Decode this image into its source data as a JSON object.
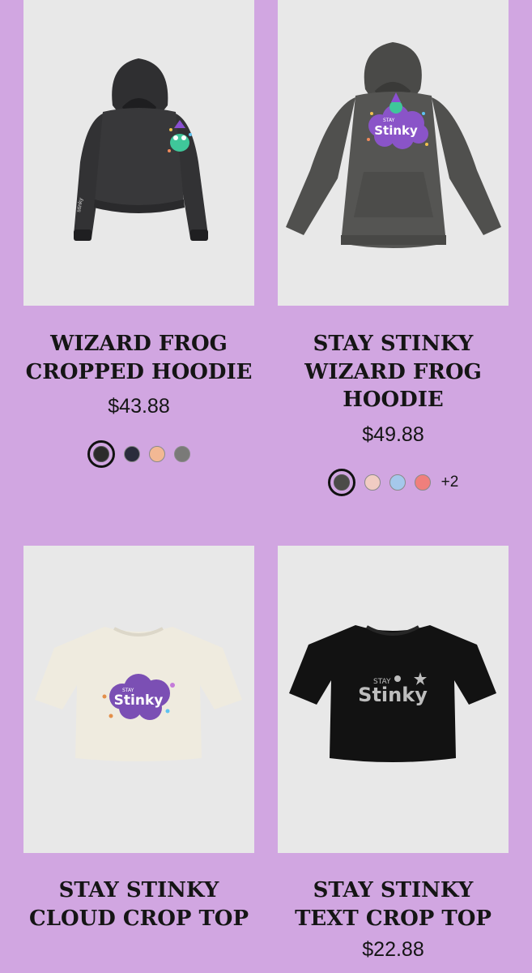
{
  "products": [
    {
      "title": "Wizard Frog Cropped Hoodie",
      "price": "$43.88",
      "swatches": [
        "#2b2b2b",
        "#2a2c3c",
        "#f2b894",
        "#7a7a78"
      ],
      "more": ""
    },
    {
      "title": "Stay Stinky Wizard Frog Hoodie",
      "price": "$49.88",
      "swatches": [
        "#4b4b48",
        "#f1ccc3",
        "#a5c8eb",
        "#f07f7c"
      ],
      "more": "+2"
    },
    {
      "title": "Stay Stinky Cloud Crop Top",
      "price": "",
      "swatches": [],
      "more": ""
    },
    {
      "title": "Stay Stinky Text Crop Top",
      "price": "$22.88",
      "swatches": [],
      "more": ""
    }
  ],
  "graphic_text": {
    "stay": "STAY",
    "stinky": "Stinky"
  }
}
